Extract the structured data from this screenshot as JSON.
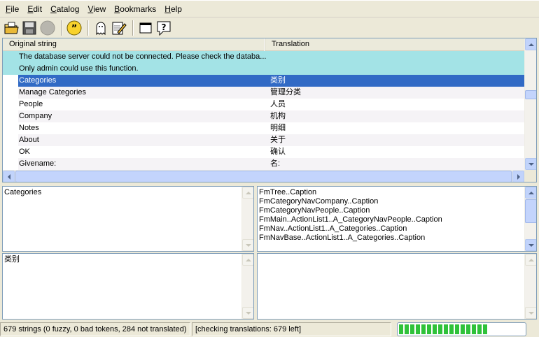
{
  "menu": [
    "File",
    "Edit",
    "Catalog",
    "View",
    "Bookmarks",
    "Help"
  ],
  "menu_underline": [
    "F",
    "E",
    "C",
    "V",
    "B",
    "H"
  ],
  "menu_rest": [
    "ile",
    "dit",
    "atalog",
    "iew",
    "ookmarks",
    "elp"
  ],
  "toolbar": {
    "buttons": [
      "open-icon",
      "save-icon",
      "disabled-circle-icon",
      "quote-icon",
      "ghost-icon",
      "edit-note-icon",
      "window-icon",
      "help-icon"
    ]
  },
  "list": {
    "col_original": "Original string",
    "col_translation": "Translation",
    "rows": [
      {
        "orig": "The database server could not be connected. Please check the databa...",
        "trans": "",
        "style": "cyan"
      },
      {
        "orig": "Only admin could use this function.",
        "trans": "",
        "style": "cyan"
      },
      {
        "orig": "Categories",
        "trans": "类别",
        "style": "sel"
      },
      {
        "orig": "Manage Categories",
        "trans": "管理分类",
        "style": "alt"
      },
      {
        "orig": "People",
        "trans": "人员",
        "style": ""
      },
      {
        "orig": "Company",
        "trans": "机构",
        "style": "alt"
      },
      {
        "orig": "Notes",
        "trans": "明细",
        "style": ""
      },
      {
        "orig": "About",
        "trans": "关于",
        "style": "alt"
      },
      {
        "orig": "OK",
        "trans": "确认",
        "style": ""
      },
      {
        "orig": "Givename:",
        "trans": "名:",
        "style": "alt"
      }
    ]
  },
  "source_pane": {
    "text": "Categories"
  },
  "translation_pane": {
    "text": "类别"
  },
  "context_pane": {
    "lines": [
      "FmTree..Caption",
      "FmCategoryNavCompany..Caption",
      "FmCategoryNavPeople..Caption",
      "FmMain..ActionList1..A_CategoryNavPeople..Caption",
      "FmNav..ActionList1..A_Categories..Caption",
      "FmNavBase..ActionList1..A_Categories..Caption"
    ]
  },
  "status": {
    "summary": "679 strings (0 fuzzy, 0 bad tokens, 284 not translated)",
    "checking": "[checking translations: 679 left]",
    "progress": 0.72,
    "progress_color": "#2fc23a"
  }
}
